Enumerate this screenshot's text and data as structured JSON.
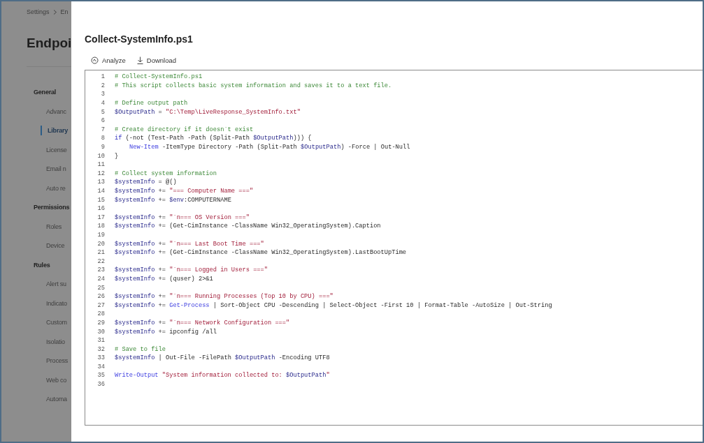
{
  "background_page": {
    "breadcrumb": [
      "Settings",
      "En"
    ],
    "title": "Endpoi",
    "nav": [
      {
        "kind": "section",
        "label": "General"
      },
      {
        "kind": "item",
        "label": "Advanc",
        "selected": false
      },
      {
        "kind": "item",
        "label": "Library",
        "selected": true
      },
      {
        "kind": "item",
        "label": "License",
        "selected": false
      },
      {
        "kind": "item",
        "label": "Email n",
        "selected": false
      },
      {
        "kind": "item",
        "label": "Auto re",
        "selected": false
      },
      {
        "kind": "section",
        "label": "Permissions"
      },
      {
        "kind": "item",
        "label": "Roles",
        "selected": false
      },
      {
        "kind": "item",
        "label": "Device",
        "selected": false
      },
      {
        "kind": "section",
        "label": "Rules"
      },
      {
        "kind": "item",
        "label": "Alert su",
        "selected": false
      },
      {
        "kind": "item",
        "label": "Indicato",
        "selected": false
      },
      {
        "kind": "item",
        "label": "Custom",
        "selected": false
      },
      {
        "kind": "item",
        "label": "Isolatio",
        "selected": false
      },
      {
        "kind": "item",
        "label": "Process",
        "selected": false
      },
      {
        "kind": "item",
        "label": "Web co",
        "selected": false
      },
      {
        "kind": "item",
        "label": "Automa",
        "selected": false
      }
    ]
  },
  "panel": {
    "title": "Collect-SystemInfo.ps1",
    "toolbar": [
      {
        "kind": "analyze",
        "label": "Analyze"
      },
      {
        "kind": "download",
        "label": "Download"
      }
    ],
    "code": [
      {
        "number": "1",
        "tokens": [
          {
            "kind": "comment",
            "text": "# Collect-SystemInfo.ps1"
          }
        ]
      },
      {
        "number": "2",
        "tokens": [
          {
            "kind": "comment",
            "text": "# This script collects basic system information and saves it to a text file."
          }
        ]
      },
      {
        "number": "3"
      },
      {
        "number": "4",
        "tokens": [
          {
            "kind": "comment",
            "text": "# Define output path"
          }
        ]
      },
      {
        "number": "5",
        "tokens": [
          {
            "kind": "variable",
            "text": "$OutputPath"
          },
          {
            "kind": "plain",
            "text": " = "
          },
          {
            "kind": "string",
            "text": "\"C:\\Temp\\LiveResponse_SystemInfo.txt\""
          }
        ]
      },
      {
        "number": "6"
      },
      {
        "number": "7",
        "tokens": [
          {
            "kind": "comment",
            "text": "# Create directory if it doesn`t exist"
          }
        ]
      },
      {
        "number": "8",
        "tokens": [
          {
            "kind": "keyword",
            "text": "if"
          },
          {
            "kind": "plain",
            "text": " (-not (Test-Path -Path (Split-Path "
          },
          {
            "kind": "variable",
            "text": "$OutputPath"
          },
          {
            "kind": "plain",
            "text": "))) {"
          }
        ]
      },
      {
        "number": "9",
        "indent": true,
        "tokens": [
          {
            "kind": "cmdlet",
            "text": "New-Item"
          },
          {
            "kind": "plain",
            "text": " -ItemType Directory -Path (Split-Path "
          },
          {
            "kind": "variable",
            "text": "$OutputPath"
          },
          {
            "kind": "plain",
            "text": ") -Force | Out-Null"
          }
        ]
      },
      {
        "number": "10",
        "tokens": [
          {
            "kind": "plain",
            "text": "}"
          }
        ]
      },
      {
        "number": "11"
      },
      {
        "number": "12",
        "tokens": [
          {
            "kind": "comment",
            "text": "# Collect system information"
          }
        ]
      },
      {
        "number": "13",
        "tokens": [
          {
            "kind": "variable",
            "text": "$systemInfo"
          },
          {
            "kind": "plain",
            "text": " = @()"
          }
        ]
      },
      {
        "number": "14",
        "tokens": [
          {
            "kind": "variable",
            "text": "$systemInfo"
          },
          {
            "kind": "plain",
            "text": " += "
          },
          {
            "kind": "string",
            "text": "\"=== Computer Name ===\""
          }
        ]
      },
      {
        "number": "15",
        "tokens": [
          {
            "kind": "variable",
            "text": "$systemInfo"
          },
          {
            "kind": "plain",
            "text": " += "
          },
          {
            "kind": "variable",
            "text": "$env"
          },
          {
            "kind": "plain",
            "text": ":COMPUTERNAME"
          }
        ]
      },
      {
        "number": "16"
      },
      {
        "number": "17",
        "tokens": [
          {
            "kind": "variable",
            "text": "$systemInfo"
          },
          {
            "kind": "plain",
            "text": " += "
          },
          {
            "kind": "string",
            "text": "\"`n=== OS Version ===\""
          }
        ]
      },
      {
        "number": "18",
        "tokens": [
          {
            "kind": "variable",
            "text": "$systemInfo"
          },
          {
            "kind": "plain",
            "text": " += (Get-CimInstance -ClassName Win32_OperatingSystem).Caption"
          }
        ]
      },
      {
        "number": "19"
      },
      {
        "number": "20",
        "tokens": [
          {
            "kind": "variable",
            "text": "$systemInfo"
          },
          {
            "kind": "plain",
            "text": " += "
          },
          {
            "kind": "string",
            "text": "\"`n=== Last Boot Time ===\""
          }
        ]
      },
      {
        "number": "21",
        "tokens": [
          {
            "kind": "variable",
            "text": "$systemInfo"
          },
          {
            "kind": "plain",
            "text": " += (Get-CimInstance -ClassName Win32_OperatingSystem).LastBootUpTime"
          }
        ]
      },
      {
        "number": "22"
      },
      {
        "number": "23",
        "tokens": [
          {
            "kind": "variable",
            "text": "$systemInfo"
          },
          {
            "kind": "plain",
            "text": " += "
          },
          {
            "kind": "string",
            "text": "\"`n=== Logged in Users ===\""
          }
        ]
      },
      {
        "number": "24",
        "tokens": [
          {
            "kind": "variable",
            "text": "$systemInfo"
          },
          {
            "kind": "plain",
            "text": " += (quser) 2>&1"
          }
        ]
      },
      {
        "number": "25"
      },
      {
        "number": "26",
        "tokens": [
          {
            "kind": "variable",
            "text": "$systemInfo"
          },
          {
            "kind": "plain",
            "text": " += "
          },
          {
            "kind": "string",
            "text": "\"`n=== Running Processes (Top 10 by CPU) ===\""
          }
        ]
      },
      {
        "number": "27",
        "tokens": [
          {
            "kind": "variable",
            "text": "$systemInfo"
          },
          {
            "kind": "plain",
            "text": " += "
          },
          {
            "kind": "cmdlet",
            "text": "Get-Process"
          },
          {
            "kind": "plain",
            "text": " | Sort-Object CPU -Descending | Select-Object -First 10 | Format-Table -AutoSize | Out-String"
          }
        ]
      },
      {
        "number": "28"
      },
      {
        "number": "29",
        "tokens": [
          {
            "kind": "variable",
            "text": "$systemInfo"
          },
          {
            "kind": "plain",
            "text": " += "
          },
          {
            "kind": "string",
            "text": "\"`n=== Network Configuration ===\""
          }
        ]
      },
      {
        "number": "30",
        "tokens": [
          {
            "kind": "variable",
            "text": "$systemInfo"
          },
          {
            "kind": "plain",
            "text": " += ipconfig /all"
          }
        ]
      },
      {
        "number": "31"
      },
      {
        "number": "32",
        "tokens": [
          {
            "kind": "comment",
            "text": "# Save to file"
          }
        ]
      },
      {
        "number": "33",
        "tokens": [
          {
            "kind": "variable",
            "text": "$systemInfo"
          },
          {
            "kind": "plain",
            "text": " | Out-File -FilePath "
          },
          {
            "kind": "variable",
            "text": "$OutputPath"
          },
          {
            "kind": "plain",
            "text": " -Encoding UTF8"
          }
        ]
      },
      {
        "number": "34"
      },
      {
        "number": "35",
        "tokens": [
          {
            "kind": "cmdlet",
            "text": "Write-Output"
          },
          {
            "kind": "string",
            "text": " \"System information collected to: "
          },
          {
            "kind": "variable",
            "text": "$OutputPath"
          },
          {
            "kind": "string",
            "text": "\""
          }
        ]
      },
      {
        "number": "36"
      }
    ]
  }
}
